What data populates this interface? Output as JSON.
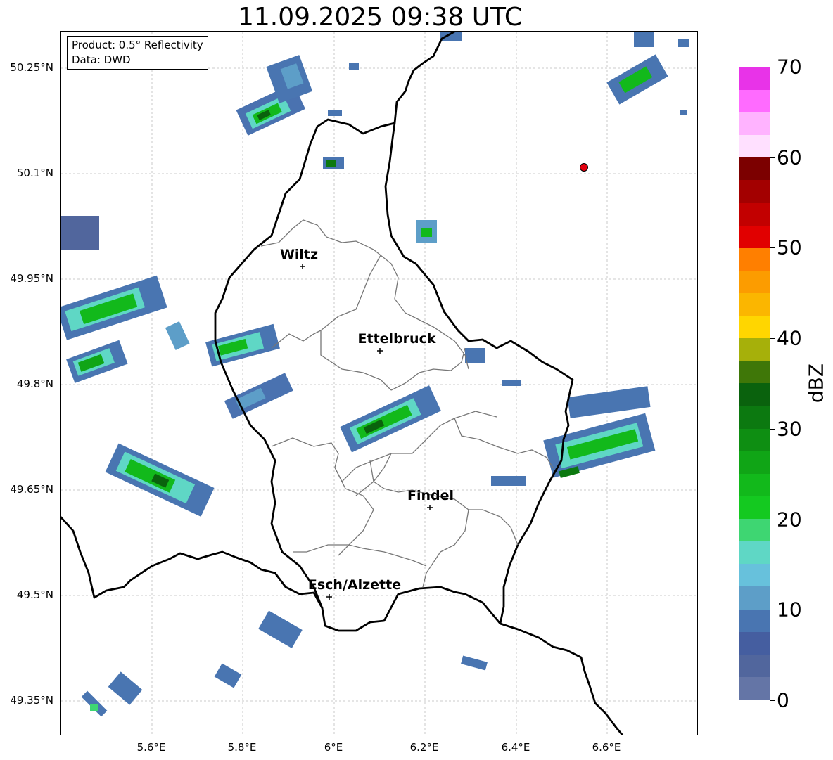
{
  "title": "11.09.2025 09:38 UTC",
  "info_box": {
    "product": "Product: 0.5° Reflectivity",
    "data": "Data: DWD"
  },
  "axes": {
    "lat_ticks": [
      "50.25°N",
      "50.1°N",
      "49.95°N",
      "49.8°N",
      "49.65°N",
      "49.5°N",
      "49.35°N"
    ],
    "lon_ticks": [
      "5.6°E",
      "5.8°E",
      "6°E",
      "6.2°E",
      "6.4°E",
      "6.6°E"
    ],
    "grid": true
  },
  "cities": [
    {
      "name": "Wiltz"
    },
    {
      "name": "Ettelbruck"
    },
    {
      "name": "Findel"
    },
    {
      "name": "Esch/Alzette"
    }
  ],
  "marker": {
    "color": "#e3000f",
    "note": "red-dot"
  },
  "colorbar": {
    "unit": "dBZ",
    "ticks": [
      "0",
      "10",
      "20",
      "30",
      "40",
      "50",
      "60",
      "70"
    ],
    "colors": [
      "#6475a6",
      "#51669d",
      "#455ea0",
      "#4975b1",
      "#5d9ec8",
      "#67c1dc",
      "#5fd7c5",
      "#3ed672",
      "#14c920",
      "#12b91b",
      "#10a516",
      "#0e8e12",
      "#0c7910",
      "#0a620d",
      "#3f7708",
      "#a6b00a",
      "#ffd600",
      "#fbb600",
      "#fc9c00",
      "#ff7f00",
      "#e10000",
      "#c20000",
      "#a30000",
      "#7c0000",
      "#ffe0ff",
      "#ffb3ff",
      "#ff6bff",
      "#e833e8"
    ]
  }
}
